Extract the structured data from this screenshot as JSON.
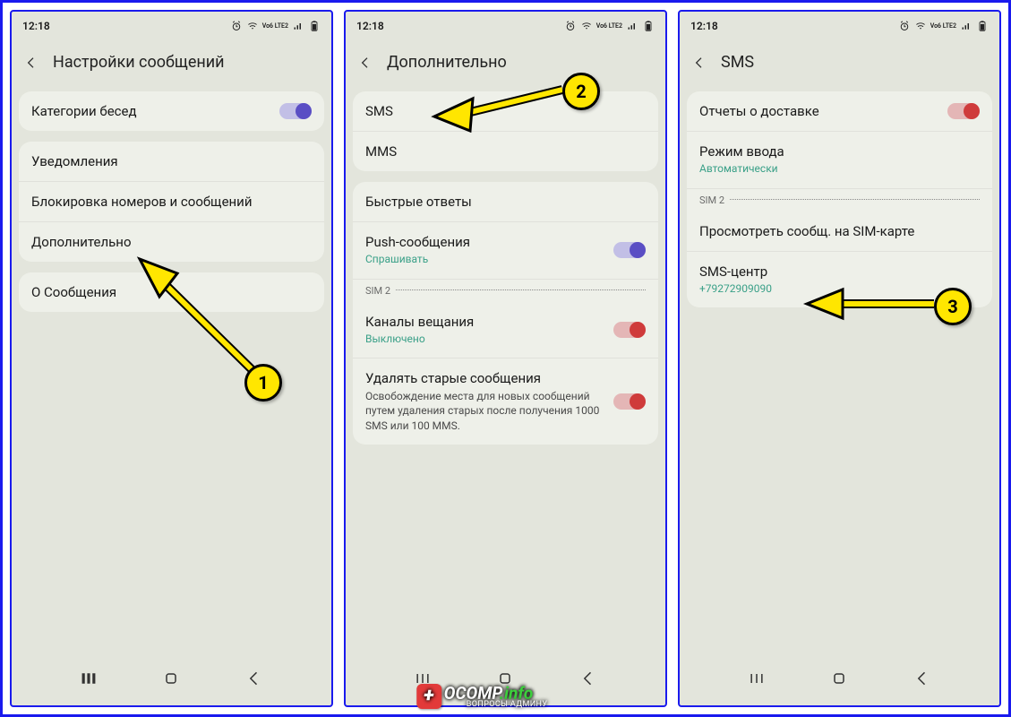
{
  "status": {
    "time": "12:18",
    "lte_label": "Vo6 LTE2"
  },
  "screens": [
    {
      "title": "Настройки сообщений",
      "groups": [
        {
          "rows": [
            {
              "label": "Категории бесед",
              "toggle": "on-purple"
            }
          ]
        },
        {
          "rows": [
            {
              "label": "Уведомления"
            },
            {
              "label": "Блокировка номеров и сообщений"
            },
            {
              "label": "Дополнительно"
            }
          ]
        },
        {
          "rows": [
            {
              "label": "О Сообщения"
            }
          ]
        }
      ]
    },
    {
      "title": "Дополнительно",
      "groups": [
        {
          "rows": [
            {
              "label": "SMS"
            },
            {
              "label": "MMS"
            }
          ]
        },
        {
          "rows": [
            {
              "label": "Быстрые ответы"
            },
            {
              "label": "Push-сообщения",
              "sub": "Спрашивать",
              "toggle": "on-purple"
            }
          ],
          "sim_divider": "SIM 2",
          "rows2": [
            {
              "label": "Каналы вещания",
              "sub": "Выключено",
              "toggle": "on-red"
            },
            {
              "label": "Удалять старые сообщения",
              "desc": "Освобождение места для новых сообщений путем удаления старых после получения 1000 SMS или 100 MMS.",
              "toggle": "on-red"
            }
          ]
        }
      ]
    },
    {
      "title": "SMS",
      "groups": [
        {
          "rows": [
            {
              "label": "Отчеты о доставке",
              "toggle": "on-red"
            },
            {
              "label": "Режим ввода",
              "sub": "Автоматически"
            }
          ],
          "sim_divider": "SIM 2",
          "rows2": [
            {
              "label": "Просмотреть сообщ. на SIM-карте"
            },
            {
              "label": "SMS-центр",
              "sub": "+79272909090"
            }
          ]
        }
      ]
    }
  ],
  "steps": {
    "b1": "1",
    "b2": "2",
    "b3": "3"
  },
  "logo": {
    "title": "OCOMP",
    "tld": ".info",
    "sub": "ВОПРОСЫ АДМИНУ"
  }
}
